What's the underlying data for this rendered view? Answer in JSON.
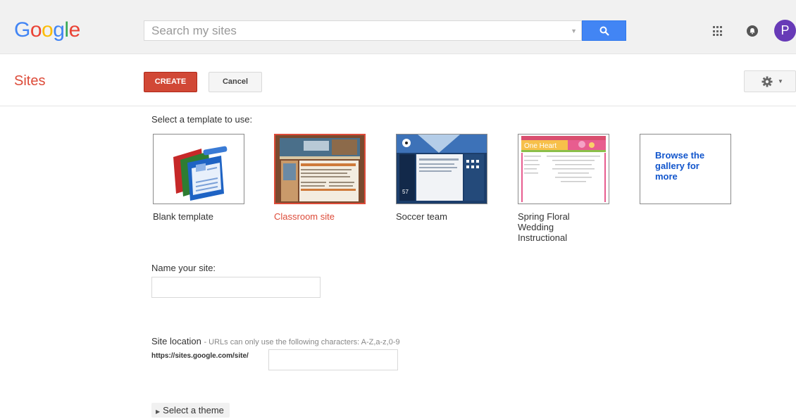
{
  "header": {
    "logo_letters": [
      "G",
      "o",
      "o",
      "g",
      "l",
      "e"
    ],
    "logo_colors": [
      "#4285f4",
      "#ea4335",
      "#fbbc05",
      "#4285f4",
      "#34a853",
      "#ea4335"
    ],
    "search_placeholder": "Search my sites",
    "avatar_initial": "P"
  },
  "toolbar": {
    "app_title": "Sites",
    "create_label": "CREATE",
    "cancel_label": "Cancel"
  },
  "templates": {
    "heading": "Select a template to use:",
    "items": [
      {
        "name": "Blank template",
        "selected": false
      },
      {
        "name": "Classroom site",
        "selected": true
      },
      {
        "name": "Soccer team",
        "selected": false
      },
      {
        "name": "Spring Floral Wedding Instructional",
        "selected": false
      }
    ],
    "browse_label": "Browse the gallery for more"
  },
  "form": {
    "name_label": "Name your site:",
    "name_value": "",
    "location_label": "Site location",
    "location_hint": "- URLs can only use the following characters: A-Z,a-z,0-9",
    "url_prefix": "https://sites.google.com/site/",
    "location_value": "",
    "theme_label": "Select a theme"
  },
  "colors": {
    "brand_red": "#dd4b39",
    "create_button": "#d14836",
    "search_button": "#4285f4",
    "link_blue": "#1155cc",
    "avatar": "#673ab7"
  }
}
